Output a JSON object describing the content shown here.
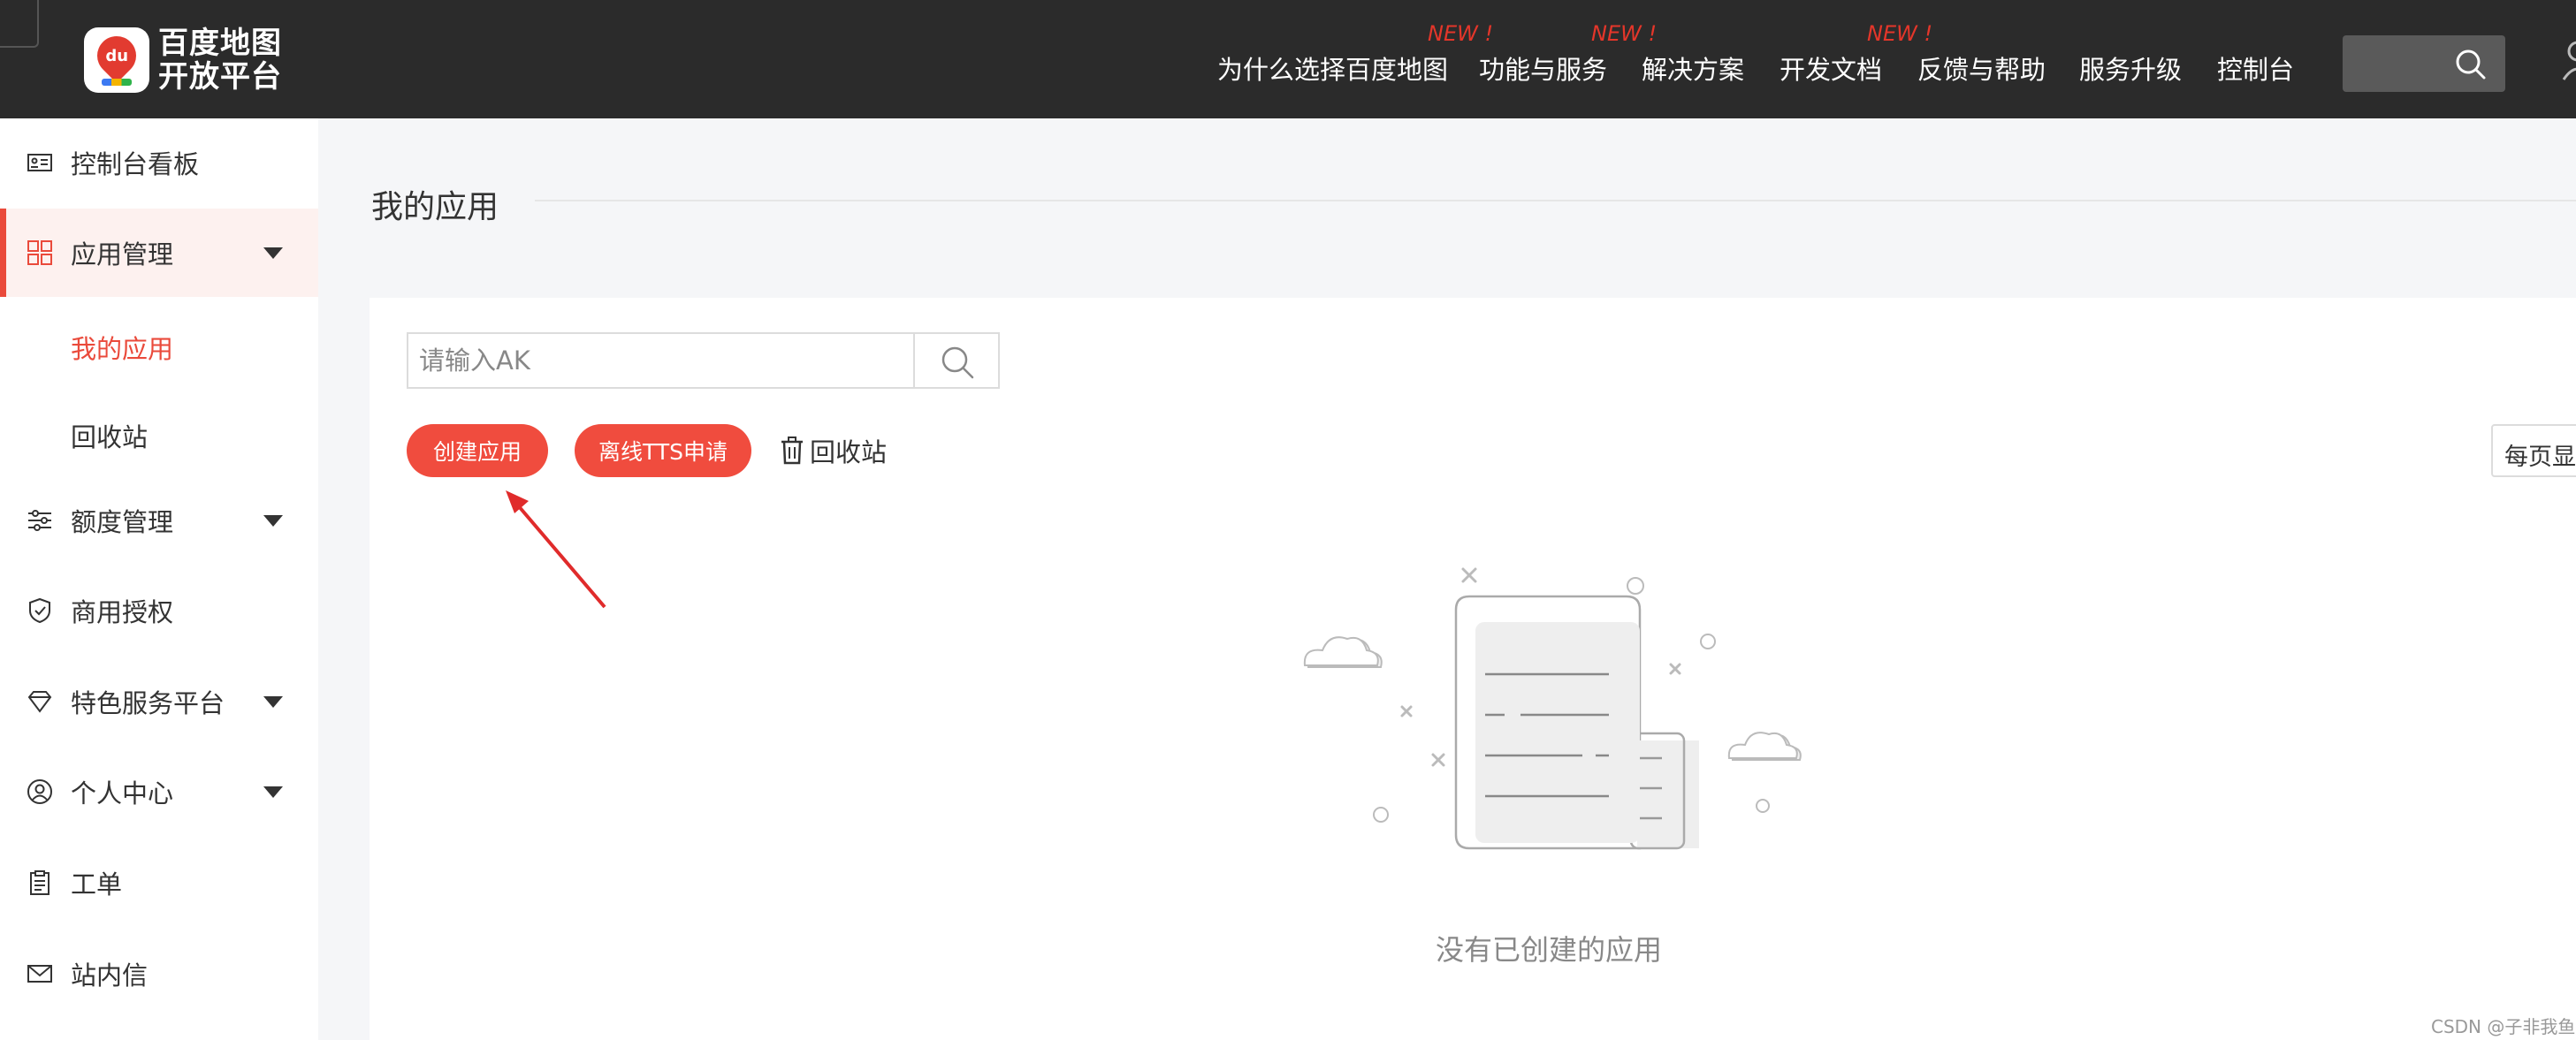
{
  "header": {
    "logo_line1": "百度地图",
    "logo_line2": "开放平台",
    "logo_badge": "du",
    "nav": [
      {
        "label": "为什么选择百度地图",
        "new": ""
      },
      {
        "label": "功能与服务",
        "new": "NEW !"
      },
      {
        "label": "解决方案",
        "new": "NEW !"
      },
      {
        "label": "开发文档",
        "new": ""
      },
      {
        "label": "反馈与帮助",
        "new": "NEW !"
      },
      {
        "label": "服务升级",
        "new": ""
      },
      {
        "label": "控制台",
        "new": ""
      }
    ]
  },
  "sidebar": {
    "items": [
      {
        "label": "控制台看板",
        "icon": "dashboard-card-icon"
      },
      {
        "label": "应用管理",
        "icon": "grid-icon"
      },
      {
        "label": "额度管理",
        "icon": "sliders-icon"
      },
      {
        "label": "商用授权",
        "icon": "shield-check-icon"
      },
      {
        "label": "特色服务平台",
        "icon": "diamond-icon"
      },
      {
        "label": "个人中心",
        "icon": "user-circle-icon"
      },
      {
        "label": "工单",
        "icon": "clipboard-icon"
      },
      {
        "label": "站内信",
        "icon": "mail-icon"
      }
    ],
    "sub_items": [
      {
        "label": "我的应用"
      },
      {
        "label": "回收站"
      }
    ]
  },
  "main": {
    "title": "我的应用",
    "search": {
      "placeholder": "请输入AK",
      "value": ""
    },
    "create_button": "创建应用",
    "tts_button": "离线TTS申请",
    "recycle_link": "回收站",
    "per_page_label": "每页显",
    "empty_text": "没有已创建的应用"
  },
  "footer": {
    "watermark": "CSDN @子非我鱼"
  },
  "colors": {
    "topbar": "#2b2b2b",
    "accent": "#f04c3e",
    "active_bg": "#fdf1ef",
    "new_badge": "#e4362a"
  }
}
